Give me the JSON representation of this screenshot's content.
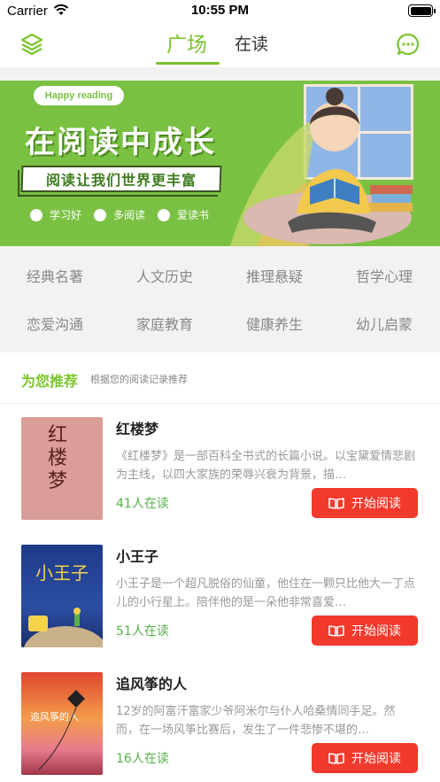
{
  "status_bar": {
    "carrier": "Carrier",
    "time": "10:55 PM"
  },
  "nav": {
    "left_icon": "layers-icon",
    "right_icon": "chat-bubble-icon",
    "tabs": [
      {
        "label": "广场",
        "active": true
      },
      {
        "label": "在读",
        "active": false
      }
    ],
    "accent_color": "#7ac52b"
  },
  "banner": {
    "badge": "Happy reading",
    "title": "在阅读中成长",
    "subtitle": "阅读让我们世界更丰富",
    "bullets": [
      "学习好",
      "多阅读",
      "爱读书"
    ]
  },
  "categories": [
    "经典名著",
    "人文历史",
    "推理悬疑",
    "哲学心理",
    "恋爱沟通",
    "家庭教育",
    "健康养生",
    "幼儿启蒙"
  ],
  "recommend": {
    "title": "为您推荐",
    "subtitle": "根据您的阅读记录推荐"
  },
  "books": [
    {
      "title": "红楼梦",
      "desc": "《红楼梦》是一部百科全书式的长篇小说。以宝黛爱情悲剧为主线，以四大家族的荣辱兴衰为背景，描…",
      "count": "41人在读",
      "button": "开始阅读",
      "cover_text": "红楼梦"
    },
    {
      "title": "小王子",
      "desc": "小王子是一个超凡脱俗的仙童，他住在一颗只比他大一丁点儿的小行星上。陪伴他的是一朵他非常喜爱…",
      "count": "51人在读",
      "button": "开始阅读",
      "cover_text": "小王子"
    },
    {
      "title": "追风筝的人",
      "desc": "12岁的阿富汗富家少爷阿米尔与仆人哈桑情同手足。然而，在一场风筝比赛后，发生了一件悲惨不堪的…",
      "count": "16人在读",
      "button": "开始阅读",
      "cover_text": "追风筝的人"
    }
  ],
  "colors": {
    "button_red": "#f23a2c",
    "count_green": "#56b04a",
    "banner_green": "#7ac143"
  }
}
